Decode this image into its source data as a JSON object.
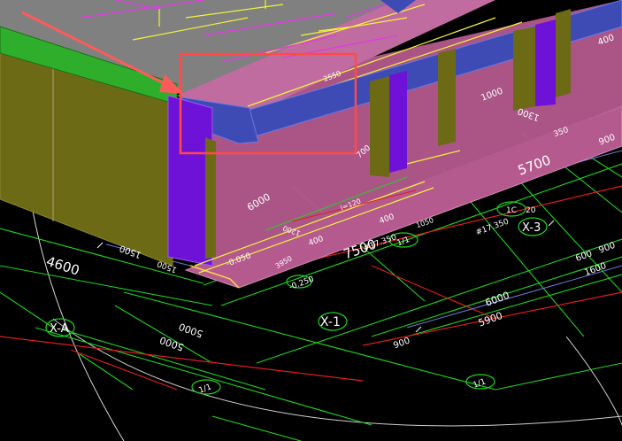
{
  "viewport": {
    "background": "#000000"
  },
  "colors": {
    "cad_green": "#21d321",
    "cad_red": "#e11d1d",
    "cad_white": "#ffffff",
    "cad_blue_dim": "#6a7bd4",
    "roof_gray": "#808080",
    "slab_pink": "#b45a8e",
    "wall_olive": "#6d6a16",
    "column_purple": "#6f12d8",
    "beam_blue": "#3e4bb5",
    "parapet_green": "#2fae2b",
    "rebar_yellow": "#f2f23a",
    "rebar_magenta": "#e03be0",
    "highlight_box": "#ff4a4a",
    "arrow": "#ff5a5a"
  },
  "axis_labels": {
    "x1": "X-1",
    "x3": "X-3",
    "xa": "X-A",
    "x2": "1/1",
    "x4": "1/1",
    "x5": "1/1"
  },
  "dimensions": {
    "d_4600": "4600",
    "d_7500": "7500",
    "d_5700": "5700",
    "d_6000a": "6000",
    "d_6000b": "6000",
    "d_5000a": "5000",
    "d_5000b": "5000",
    "d_1500a": "1500",
    "d_1500b": "1500",
    "d_1300": "1300",
    "d_1000": "1000",
    "d_900a": "900",
    "d_900b": "900",
    "d_900c": "900",
    "d_5900": "5900",
    "d_600": "600",
    "d_400a": "400",
    "d_400b": "400",
    "d_400c": "400",
    "d_1600": "1600",
    "d_1200": "1200",
    "d_350": "350",
    "d_1050": "1050",
    "d_700": "700",
    "d_3950": "3950",
    "d_2550": "2550",
    "d_1c": "1C",
    "d_20": "20"
  },
  "elevations": {
    "e1": "-0.050",
    "e2": "-0.250",
    "e3": "#17.350",
    "e4": "#17.350",
    "e5": "i=120"
  }
}
